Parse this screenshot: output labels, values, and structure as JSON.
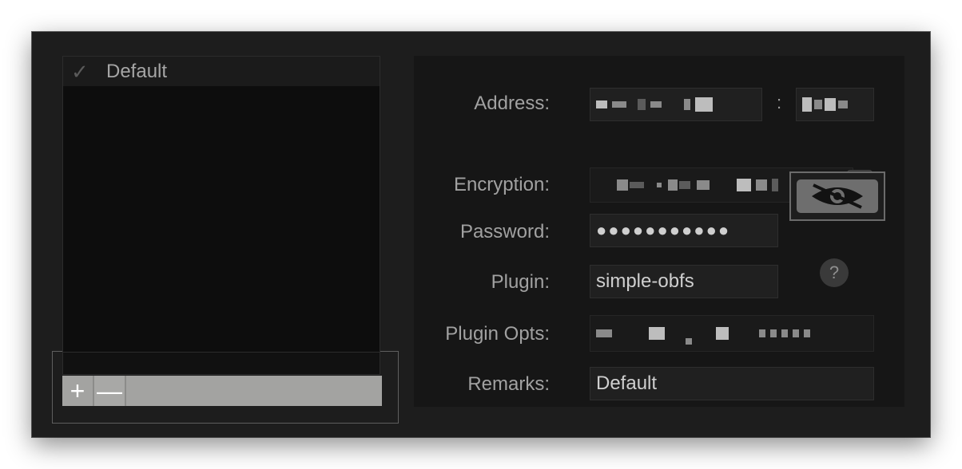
{
  "list": {
    "items": [
      {
        "label": "Default",
        "checked": true,
        "check_glyph": "✓"
      }
    ]
  },
  "list_toolbar": {
    "add_label": "+",
    "remove_label": "—"
  },
  "form": {
    "address_label": "Address:",
    "address_value": "[redacted]",
    "port_separator": ":",
    "port_value": "[redacted]",
    "encryption_label": "Encryption:",
    "encryption_value": "[redacted]",
    "password_label": "Password:",
    "password_value": "●●●●●●●●●●●",
    "plugin_label": "Plugin:",
    "plugin_value": "simple-obfs",
    "plugin_opts_label": "Plugin Opts:",
    "plugin_opts_value": "[redacted]",
    "remarks_label": "Remarks:",
    "remarks_value": "Default",
    "help_glyph": "?"
  },
  "icons": {
    "check": "checkmark-icon",
    "dropdown": "chevron-down-icon",
    "password_toggle": "eye-slash-icon",
    "help": "help-icon"
  },
  "colors": {
    "window_bg": "#1d1d1d",
    "list_bg": "#0d0d0d",
    "form_bg": "#161616",
    "field_bg": "#202020",
    "bar_bg": "#a3a3a1"
  }
}
